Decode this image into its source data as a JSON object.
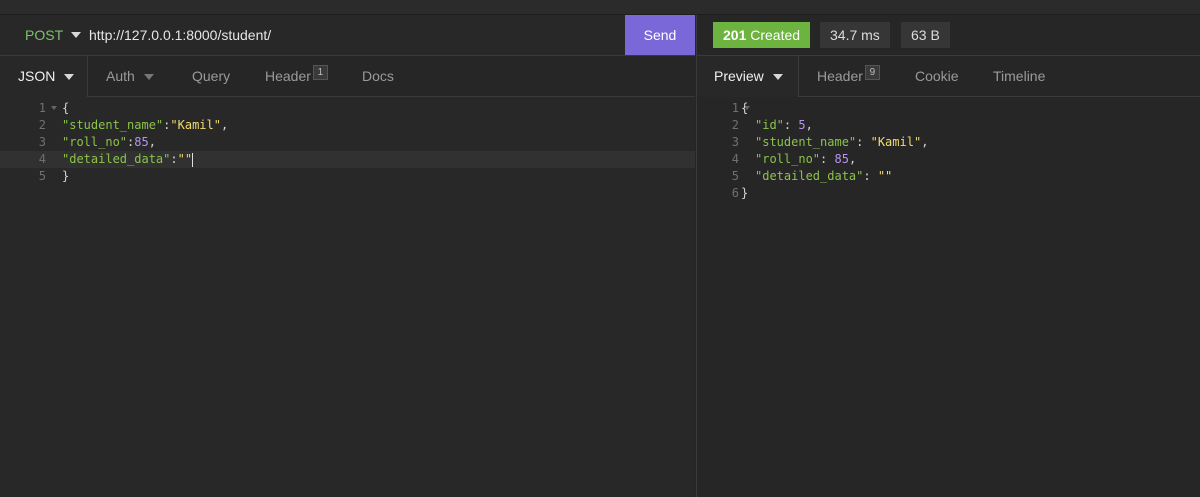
{
  "request": {
    "method": "POST",
    "url": "http://127.0.0.1:8000/student/",
    "send_label": "Send",
    "tabs": [
      {
        "label": "JSON"
      },
      {
        "label": "Auth"
      },
      {
        "label": "Query"
      },
      {
        "label": "Header",
        "badge": "1"
      },
      {
        "label": "Docs"
      }
    ],
    "body": {
      "line_numbers": [
        "1",
        "2",
        "3",
        "4",
        "5"
      ],
      "open_brace": "{",
      "close_brace": "}",
      "k1": "\"student_name\"",
      "v1": "\"Kamil\"",
      "k2": "\"roll_no\"",
      "v2": "85",
      "k3": "\"detailed_data\"",
      "v3": "\"\""
    }
  },
  "response": {
    "status_code": "201",
    "status_text": "Created",
    "time": "34.7 ms",
    "size": "63 B",
    "tabs": [
      {
        "label": "Preview"
      },
      {
        "label": "Header",
        "badge": "9"
      },
      {
        "label": "Cookie"
      },
      {
        "label": "Timeline"
      }
    ],
    "body": {
      "line_numbers": [
        "1",
        "2",
        "3",
        "4",
        "5",
        "6"
      ],
      "open_brace": "{",
      "close_brace": "}",
      "k1": "\"id\"",
      "v1": "5",
      "k2": "\"student_name\"",
      "v2": "\"Kamil\"",
      "k3": "\"roll_no\"",
      "v3": "85",
      "k4": "\"detailed_data\"",
      "v4": "\"\""
    }
  },
  "colors": {
    "accent_send": "#7a67d8",
    "status_success": "#6cb33f",
    "method_post": "#7ec26a"
  }
}
